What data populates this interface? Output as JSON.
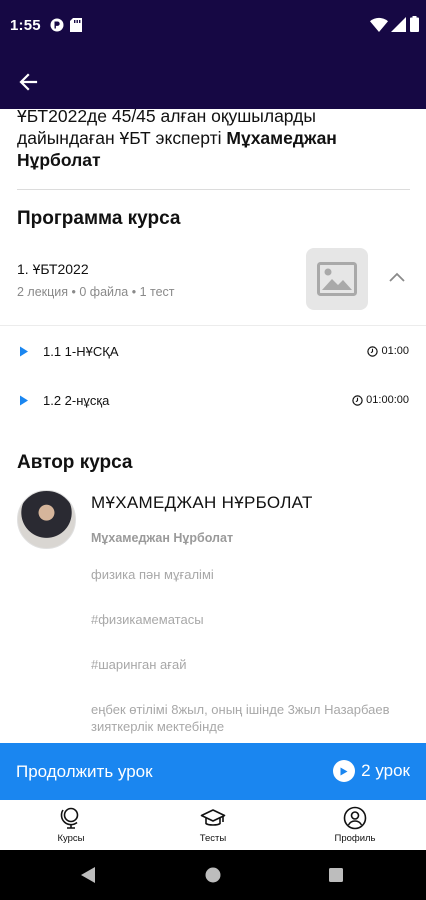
{
  "status_bar": {
    "time": "1:55"
  },
  "description": {
    "line_plain": "ҰБТ2022де 45/45 алған оқушыларды дайындаған ҰБТ эксперті ",
    "line_bold": "Мұхамеджан Нұрболат"
  },
  "program": {
    "title": "Программа курса",
    "module": {
      "title": "1. ҰБТ2022",
      "meta": "2 лекция • 0 файла • 1 тест"
    },
    "lessons": [
      {
        "title": "1.1 1-НҰСҚА",
        "duration": "01:00"
      },
      {
        "title": "1.2 2-нұсқа",
        "duration": "01:00:00"
      }
    ]
  },
  "author": {
    "section_title": "Автор курса",
    "name": "МҰХАМЕДЖАН НҰРБОЛАТ",
    "sub_name": "Мұхамеджан Нұрболат",
    "bio_lines": [
      "физика пән мұғалімі",
      "#физикамематасы",
      "#шаринган ағай",
      "еңбек өтілімі 8жыл, оның ішінде 3жыл Назарбаев зияткерлік мектебінде"
    ]
  },
  "continue_bar": {
    "label": "Продолжить урок",
    "right_label": "2 урок"
  },
  "bottom_nav": {
    "items": [
      {
        "label": "Курсы",
        "icon": "globe-icon"
      },
      {
        "label": "Тесты",
        "icon": "graduation-cap-icon"
      },
      {
        "label": "Профиль",
        "icon": "profile-icon"
      }
    ]
  },
  "colors": {
    "header": "#160844",
    "accent": "#1a86f0"
  }
}
